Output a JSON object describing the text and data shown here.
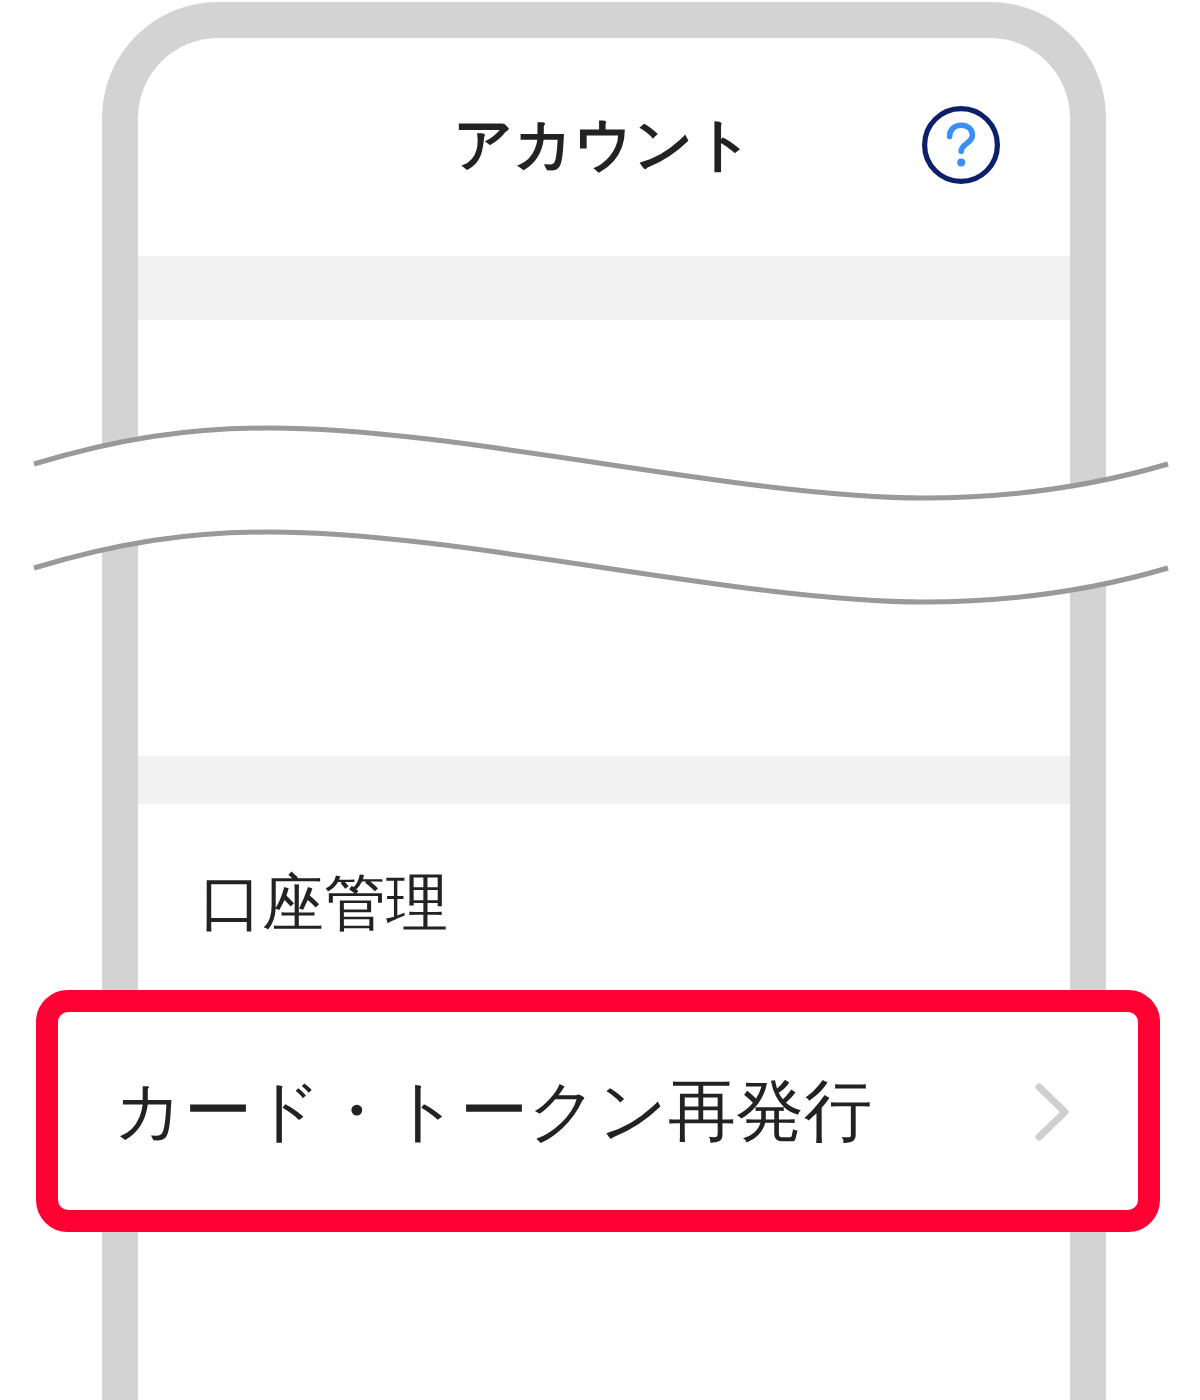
{
  "header": {
    "title": "アカウント"
  },
  "section": {
    "heading": "口座管理",
    "items": [
      {
        "label": "カード・トークン再発行",
        "highlighted": true
      }
    ]
  }
}
